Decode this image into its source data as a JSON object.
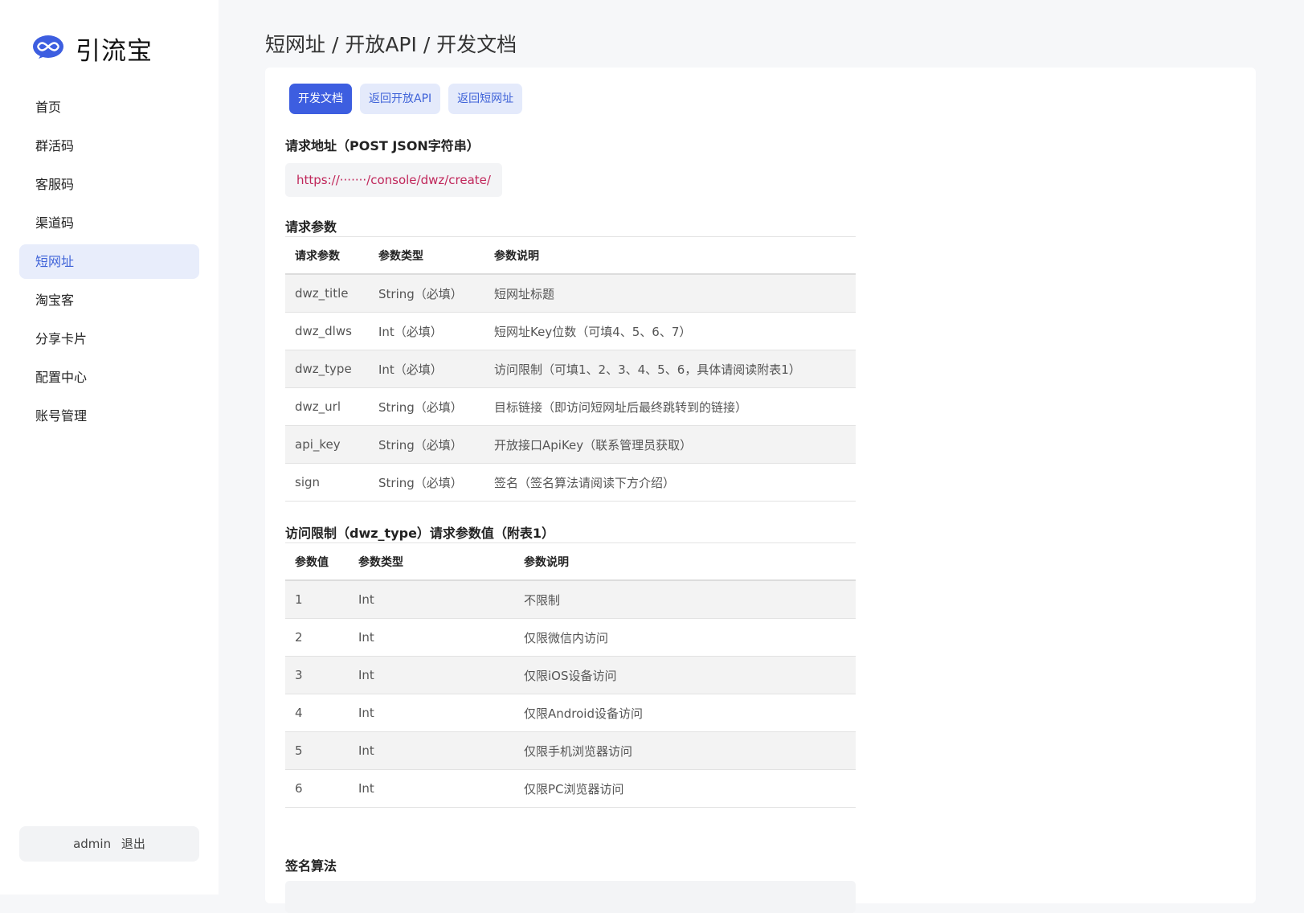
{
  "app": {
    "name": "引流宝"
  },
  "nav": {
    "items": [
      {
        "label": "首页"
      },
      {
        "label": "群活码"
      },
      {
        "label": "客服码"
      },
      {
        "label": "渠道码"
      },
      {
        "label": "短网址"
      },
      {
        "label": "淘宝客"
      },
      {
        "label": "分享卡片"
      },
      {
        "label": "配置中心"
      },
      {
        "label": "账号管理"
      }
    ],
    "active_index": 4
  },
  "user": {
    "name": "admin",
    "logout_label": "退出"
  },
  "breadcrumb": "短网址 / 开放API / 开发文档",
  "tabs": [
    {
      "label": "开发文档"
    },
    {
      "label": "返回开放API"
    },
    {
      "label": "返回短网址"
    }
  ],
  "request_url": {
    "title": "请求地址（POST JSON字符串）",
    "url": "https://·······/console/dwz/create/"
  },
  "params_table": {
    "title": "请求参数",
    "headers": [
      "请求参数",
      "参数类型",
      "参数说明"
    ],
    "rows": [
      [
        "dwz_title",
        "String（必填）",
        "短网址标题"
      ],
      [
        "dwz_dlws",
        "Int（必填）",
        "短网址Key位数（可填4、5、6、7）"
      ],
      [
        "dwz_type",
        "Int（必填）",
        "访问限制（可填1、2、3、4、5、6，具体请阅读附表1）"
      ],
      [
        "dwz_url",
        "String（必填）",
        "目标链接（即访问短网址后最终跳转到的链接）"
      ],
      [
        "api_key",
        "String（必填）",
        "开放接口ApiKey（联系管理员获取）"
      ],
      [
        "sign",
        "String（必填）",
        "签名（签名算法请阅读下方介绍）"
      ]
    ]
  },
  "type_table": {
    "title": "访问限制（dwz_type）请求参数值（附表1）",
    "headers": [
      "参数值",
      "参数类型",
      "参数说明"
    ],
    "rows": [
      [
        "1",
        "Int",
        "不限制"
      ],
      [
        "2",
        "Int",
        "仅限微信内访问"
      ],
      [
        "3",
        "Int",
        "仅限iOS设备访问"
      ],
      [
        "4",
        "Int",
        "仅限Android设备访问"
      ],
      [
        "5",
        "Int",
        "仅限手机浏览器访问"
      ],
      [
        "6",
        "Int",
        "仅限PC浏览器访问"
      ]
    ]
  },
  "sign_section": {
    "title": "签名算法"
  },
  "colors": {
    "accent": "#3d5ee0",
    "accent_light": "#e4eafb",
    "url_text": "#c0265a"
  }
}
